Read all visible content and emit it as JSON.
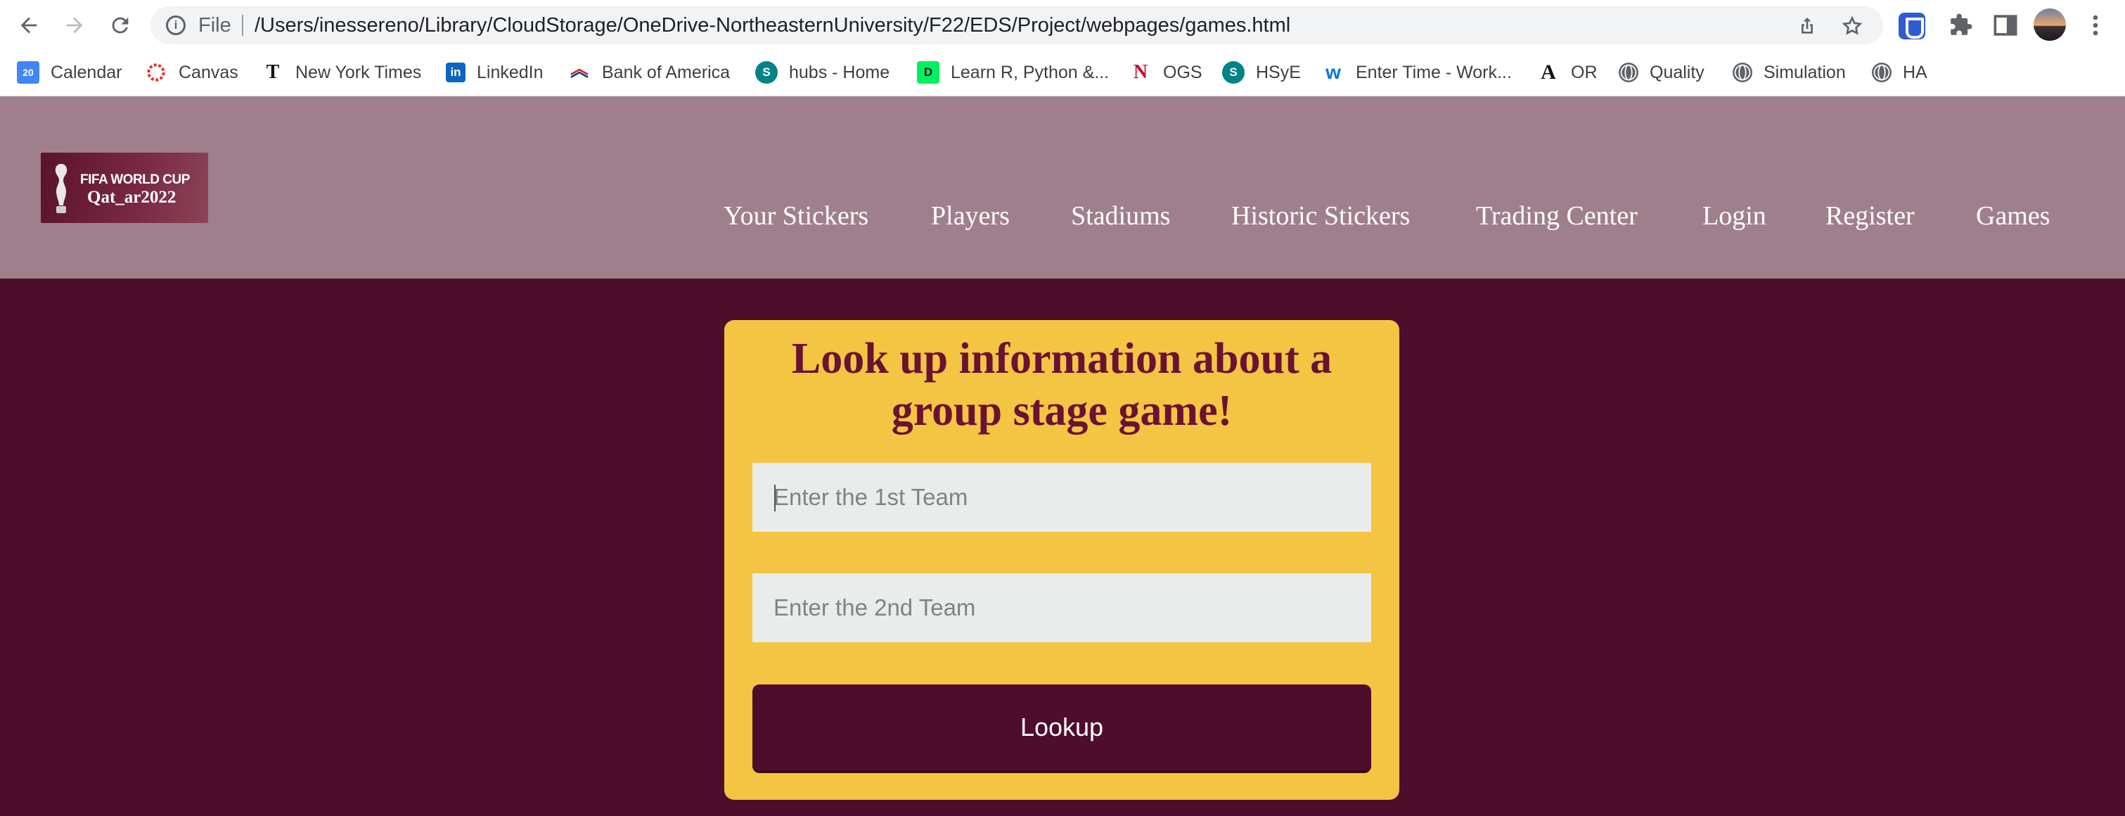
{
  "browser": {
    "scheme_label": "File",
    "url": "/Users/inessereno/Library/CloudStorage/OneDrive-NortheasternUniversity/F22/EDS/Project/webpages/games.html",
    "icons": {
      "back": "back-arrow-icon",
      "forward": "forward-arrow-icon",
      "reload": "reload-icon",
      "info": "info-icon",
      "share": "share-icon",
      "star": "bookmark-star-icon",
      "password_manager": "password-manager-icon",
      "extensions": "puzzle-icon",
      "side_panel": "side-panel-icon",
      "profile": "profile-avatar",
      "menu": "kebab-menu-icon"
    }
  },
  "bookmarks": [
    {
      "label": "Calendar",
      "icon": "calendar-icon",
      "color": "#4285f4",
      "badge": "20"
    },
    {
      "label": "Canvas",
      "icon": "canvas-icon",
      "color": "#e3342f"
    },
    {
      "label": "New York Times",
      "icon": "nyt-icon",
      "color": "#111111"
    },
    {
      "label": "LinkedIn",
      "icon": "linkedin-icon",
      "color": "#0a66c2"
    },
    {
      "label": "Bank of America",
      "icon": "boa-icon",
      "color": "#d0262c"
    },
    {
      "label": "hubs - Home",
      "icon": "sharepoint-icon",
      "color": "#038387"
    },
    {
      "label": "Learn R, Python &...",
      "icon": "datacamp-icon",
      "color": "#03ef62"
    },
    {
      "label": "OGS",
      "icon": "northeastern-icon",
      "color": "#c8102e"
    },
    {
      "label": "HSyE",
      "icon": "sharepoint-icon",
      "color": "#038387"
    },
    {
      "label": "Enter Time - Work...",
      "icon": "workday-icon",
      "color": "#f5a623"
    },
    {
      "label": "OR",
      "icon": "text-a-icon",
      "color": "#111111"
    },
    {
      "label": "Quality",
      "icon": "globe-icon",
      "color": "#5f6368"
    },
    {
      "label": "Simulation",
      "icon": "globe-icon",
      "color": "#5f6368"
    },
    {
      "label": "HA",
      "icon": "globe-icon",
      "color": "#5f6368"
    }
  ],
  "site": {
    "logo": {
      "line1": "FIFA WORLD CUP",
      "line2": "Qat_ar2022"
    },
    "nav": [
      "Your Stickers",
      "Players",
      "Stadiums",
      "Historic Stickers",
      "Trading Center",
      "Login",
      "Register",
      "Games"
    ],
    "colors": {
      "header": "#a07f8d",
      "page": "#4f0d2c",
      "card": "#f4c443",
      "title": "#6b1232"
    }
  },
  "lookup": {
    "title": "Look up information about a group stage game!",
    "team1_placeholder": "Enter the 1st Team",
    "team1_value": "",
    "team2_placeholder": "Enter the 2nd Team",
    "team2_value": "",
    "button_label": "Lookup"
  }
}
